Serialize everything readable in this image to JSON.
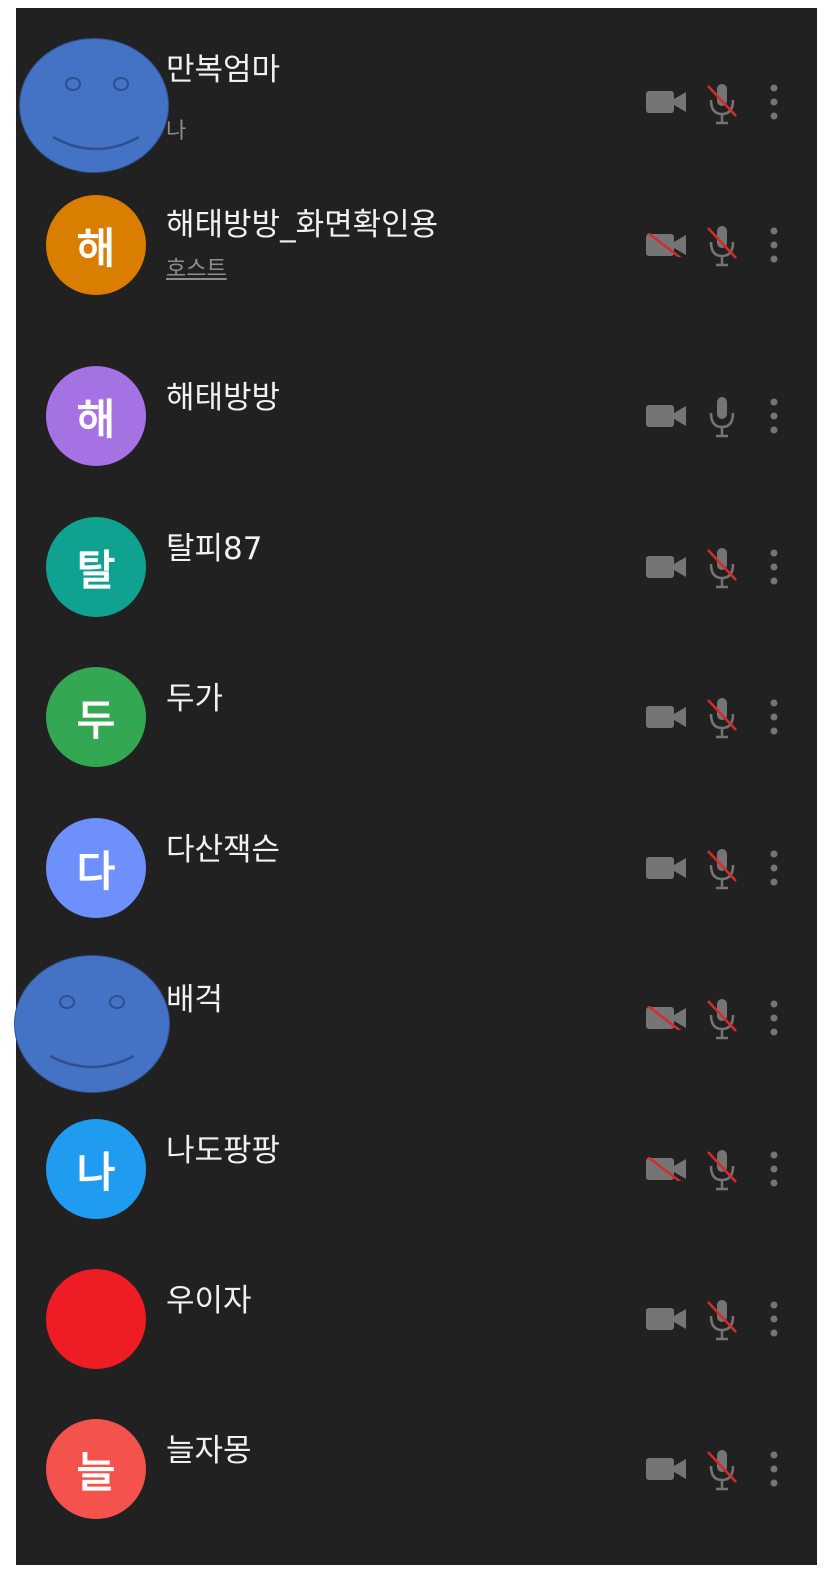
{
  "participants": [
    {
      "name": "만복엄마",
      "sub": "나",
      "avatar_type": "smiley",
      "camera": "on",
      "mic": "muted"
    },
    {
      "name": "해태방방_화면확인용",
      "sub": "호스트",
      "avatar_letter": "해",
      "avatar_color": "#d97e00",
      "camera": "off",
      "mic": "muted"
    },
    {
      "name": "해태방방",
      "avatar_letter": "해",
      "avatar_color": "#a572e4",
      "camera": "on",
      "mic": "on"
    },
    {
      "name": "탈피87",
      "avatar_letter": "탈",
      "avatar_color": "#10a291",
      "camera": "on",
      "mic": "muted"
    },
    {
      "name": "두가",
      "avatar_letter": "두",
      "avatar_color": "#33a752",
      "camera": "on",
      "mic": "muted"
    },
    {
      "name": "다산잭슨",
      "avatar_letter": "다",
      "avatar_color": "#6e90fb",
      "camera": "on",
      "mic": "muted"
    },
    {
      "name": "배걱",
      "avatar_type": "smiley",
      "camera": "off",
      "mic": "muted"
    },
    {
      "name": "나도팡팡",
      "avatar_letter": "나",
      "avatar_color": "#1f9bf0",
      "camera": "off",
      "mic": "muted"
    },
    {
      "name": "우이자",
      "avatar_letter": "",
      "avatar_color": "#ee1c25",
      "camera": "on",
      "mic": "muted"
    },
    {
      "name": "늘자몽",
      "avatar_letter": "늘",
      "avatar_color": "#f4524d",
      "camera": "on",
      "mic": "muted"
    }
  ],
  "colors": {
    "background": "#212121",
    "icon": "#757575",
    "mute_slash": "#d92a2a",
    "name_text": "#f1f1f1",
    "sub_text": "#8d8d8d"
  }
}
